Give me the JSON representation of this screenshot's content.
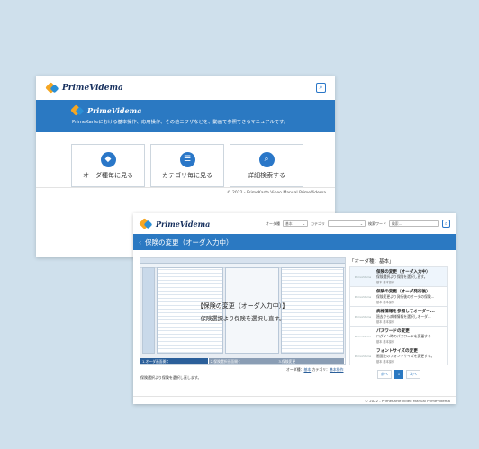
{
  "window1": {
    "logo": "PrimeVidema",
    "search_icon": "search-icon",
    "banner": {
      "logo": "PrimeVidema",
      "tagline": "PrimeKarteにおける基本操作、応用操作、その他ニワザなどを、動画で参照できるマニュアルです。"
    },
    "cards": [
      {
        "label": "オーダ種毎に見る",
        "icon": "tag-icon"
      },
      {
        "label": "カテゴリ毎に見る",
        "icon": "list-icon"
      },
      {
        "label": "詳細検索する",
        "icon": "magnifier-icon"
      }
    ],
    "footer": "© 2022 - PrimeKarte Video Manual PrimeVidema"
  },
  "window2": {
    "logo": "PrimeVidema",
    "filters": {
      "order_type_label": "オーダ種",
      "order_type_value": "基本",
      "category_label": "カテゴリ",
      "category_value": "",
      "keyword_label": "検索ワード",
      "keyword_placeholder": "検索..."
    },
    "page_title": "保険の変更（オーダ入力中）",
    "video": {
      "overlay_title": "【保険の変更（オーダ入力中）】",
      "overlay_sub": "保険選択より保険を選択し直す。",
      "steps": [
        "1.オーダ画面開く",
        "2.保険選択画面開く",
        "3.保険変更"
      ],
      "active_step": 0
    },
    "meta": {
      "order_type_label": "オーダ種：",
      "order_type_value": "基本",
      "category_label": "カテゴリ：",
      "category_value": "基本操作"
    },
    "description": "保険選択より保険を選択し直します。",
    "sidebar": {
      "title": "「オーダ種：基本」",
      "items": [
        {
          "title": "保険の変更（オーダ入力中）",
          "sub": "保険選択より保険を選択し直す。",
          "cat": "基本 基本操作",
          "thumb": "PrimeVidema"
        },
        {
          "title": "保険の変更（オーダ発行後）",
          "sub": "保険変更より発行後のオーダの保険...",
          "cat": "基本 基本操作",
          "thumb": "PrimeVidema"
        },
        {
          "title": "病様情報を参照してオーダー...",
          "sub": "過去から病様情報を選択しオーダ...",
          "cat": "基本 基本操作",
          "thumb": "PrimeVidema"
        },
        {
          "title": "パスワードの変更",
          "sub": "ログイン時のパスワードを変更する",
          "cat": "基本 基本操作",
          "thumb": "PrimeVidema"
        },
        {
          "title": "フォントサイズの変更",
          "sub": "画面上のフォントサイズを変更する。",
          "cat": "基本 基本操作",
          "thumb": "PrimeVidema"
        }
      ]
    },
    "pager": {
      "prev": "前へ",
      "current": "1",
      "next": "次へ"
    },
    "footer": "© 2022 - PrimeKarte Video Manual PrimeVidema"
  }
}
